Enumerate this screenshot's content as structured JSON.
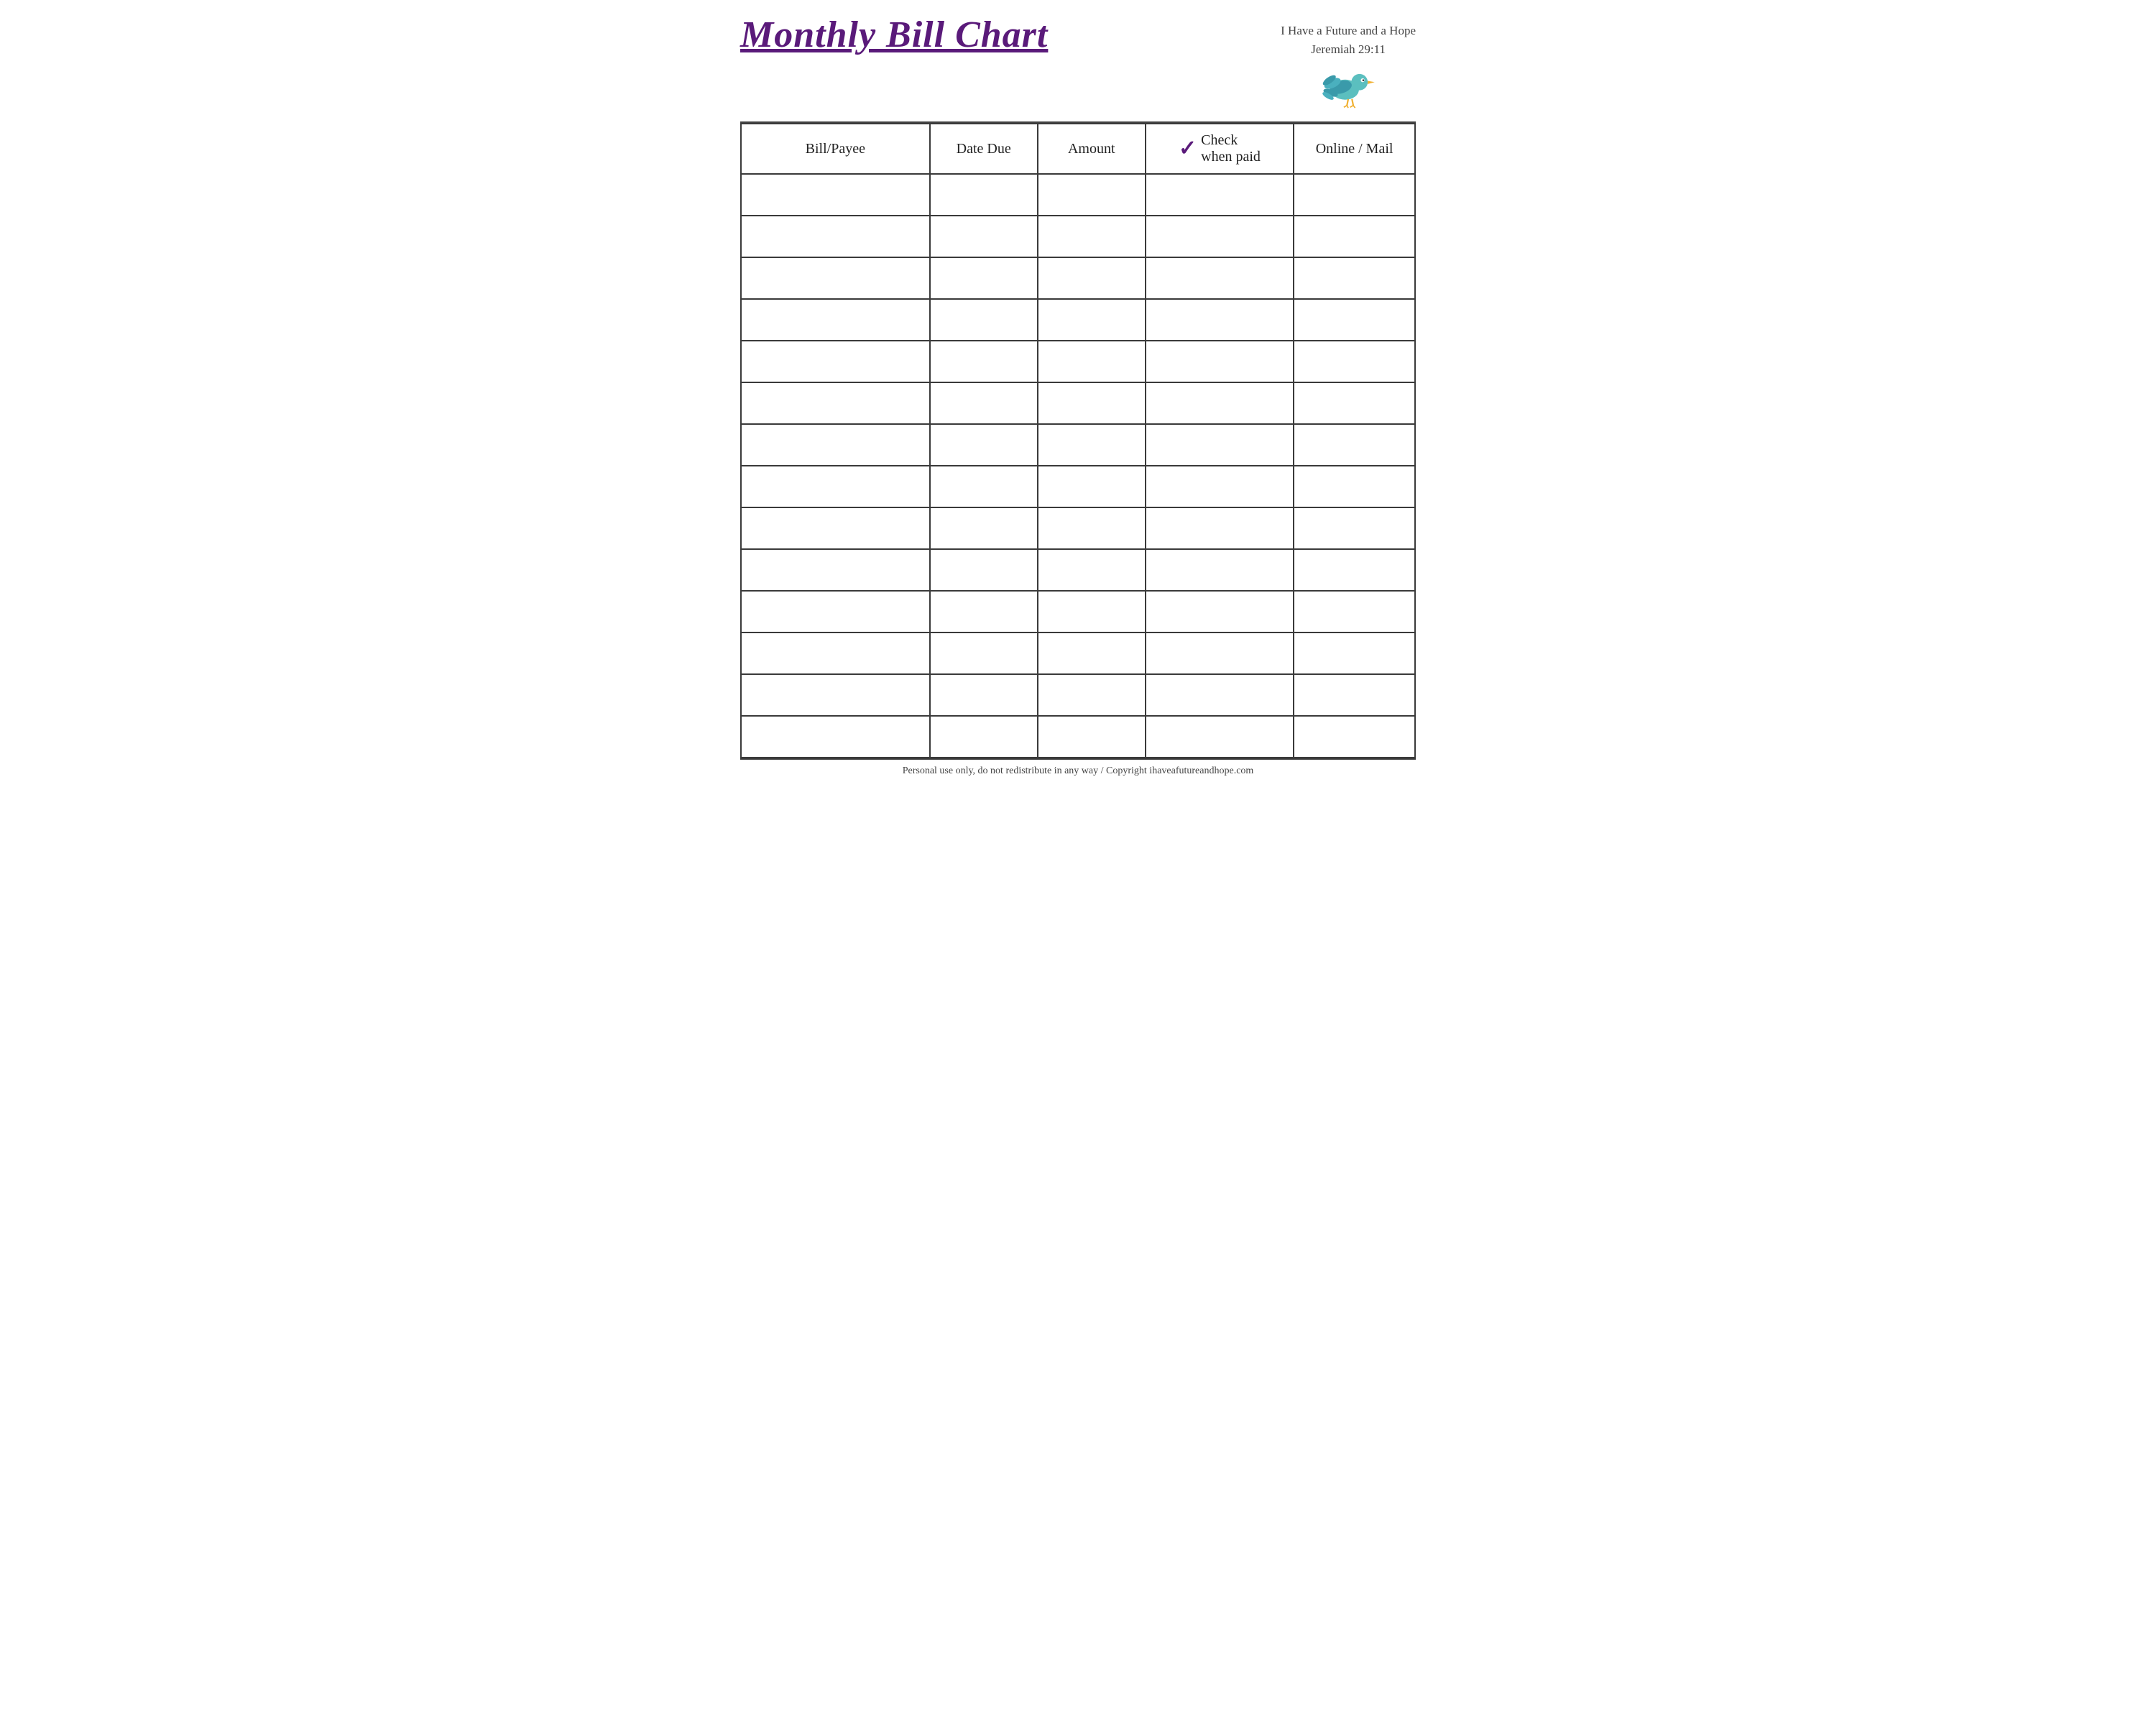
{
  "header": {
    "title": "Monthly Bill Chart",
    "tagline_line1": "I Have a Future and a Hope",
    "tagline_line2": "Jeremiah 29:11"
  },
  "table": {
    "columns": [
      {
        "id": "bill",
        "label": "Bill/Payee"
      },
      {
        "id": "date",
        "label": "Date Due"
      },
      {
        "id": "amount",
        "label": "Amount"
      },
      {
        "id": "check",
        "label_line1": "Check",
        "label_line2": "when paid",
        "has_checkmark": true
      },
      {
        "id": "online",
        "label": "Online / Mail"
      }
    ],
    "row_count": 14
  },
  "footer": {
    "text": "Personal use only, do not redistribute in any way / Copyright ihaveafutureandhope.com"
  },
  "colors": {
    "title": "#5a1a7a",
    "border": "#3a3a3a",
    "checkmark": "#5a1a7a",
    "text": "#222222",
    "bird_body": "#5bbfbf",
    "bird_wing": "#3a9aaa",
    "bird_beak": "#f0b030",
    "bird_eye": "#333333"
  }
}
